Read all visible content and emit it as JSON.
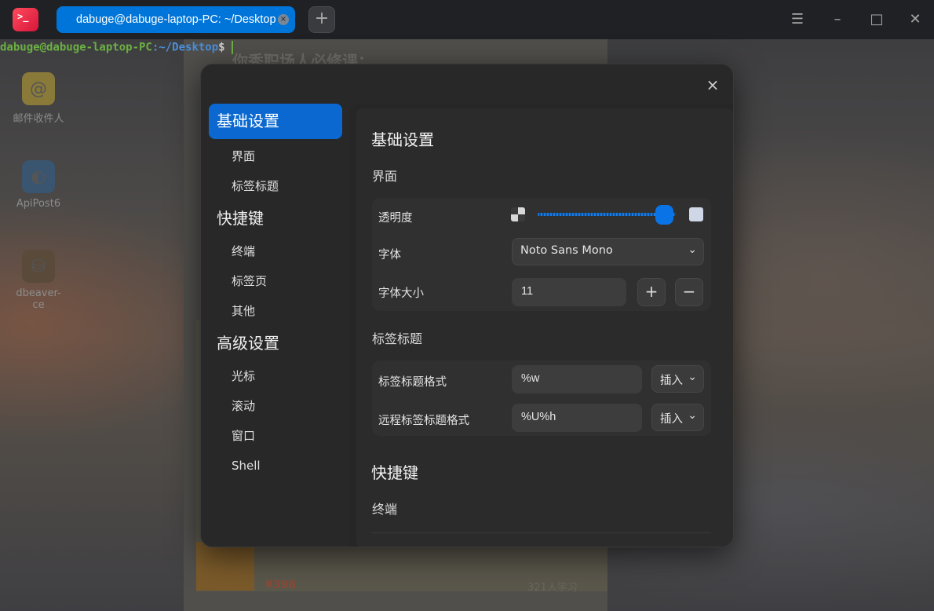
{
  "window": {
    "tab_title": "dabuge@dabuge-laptop-PC: ~/Desktop",
    "new_tab": "+",
    "tab_close": "×",
    "menu_icon": "☰",
    "minimize_icon": "–",
    "maximize_icon": "□",
    "close_icon": "✕",
    "logo_text": ">_"
  },
  "terminal": {
    "user_host": "dabuge@dabuge-laptop-PC",
    "path": ":~/Desktop",
    "symbol": "$"
  },
  "background": {
    "heading": "你秀职场人必修课：",
    "price": "¥398",
    "learners": "321人学习",
    "desktop_icons": [
      {
        "label": "邮件收件人",
        "icon": "@"
      },
      {
        "label": "ApiPost6",
        "icon": "◐"
      },
      {
        "label": "dbeaver-ce",
        "icon": "⛁"
      }
    ]
  },
  "dialog": {
    "close": "×",
    "nav": {
      "group_basic": "基础设置",
      "item_interface": "界面",
      "item_tab_title": "标签标题",
      "group_shortcuts": "快捷键",
      "item_terminal": "终端",
      "item_tabs": "标签页",
      "item_other": "其他",
      "group_advanced": "高级设置",
      "item_cursor": "光标",
      "item_scroll": "滚动",
      "item_window": "窗口",
      "item_shell": "Shell"
    },
    "content": {
      "heading_basic": "基础设置",
      "sub_interface": "界面",
      "opacity_label": "透明度",
      "opacity_value": 0.92,
      "font_label": "字体",
      "font_value": "Noto Sans Mono",
      "font_size_label": "字体大小",
      "font_size_value": "11",
      "plus": "+",
      "minus": "−",
      "sub_tab_title": "标签标题",
      "tab_title_format_label": "标签标题格式",
      "tab_title_format_value": "%w",
      "remote_tab_title_format_label": "远程标签标题格式",
      "remote_tab_title_format_value": "%U%h",
      "insert_label": "插入",
      "heading_shortcuts": "快捷键",
      "sub_terminal": "终端"
    }
  },
  "colors": {
    "accent": "#0a68d0",
    "tab_active": "#0075d9",
    "prompt_user": "#6cb043",
    "prompt_path": "#4a8fd8",
    "dialog_bg": "#282828"
  }
}
